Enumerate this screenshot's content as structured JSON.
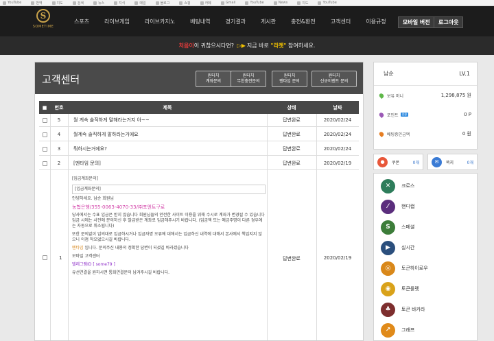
{
  "bookmarks": [
    "YouTube",
    "번역",
    "지도",
    "검색",
    "뉴스",
    "지식",
    "메일",
    "블로그",
    "쇼핑",
    "카페",
    "Gmail",
    "YouTube",
    "News",
    "지도",
    "YouTube"
  ],
  "nav": {
    "logo_text": "SOMETIME",
    "menu": [
      "스포츠",
      "라이브게임",
      "라이브카지노",
      "베팅내역",
      "경기결과",
      "게시판",
      "충전&환전",
      "고객센터",
      "이용규정"
    ],
    "mobile_label": "모바일 버전",
    "logout_label": "로그아웃"
  },
  "notice": {
    "red": "처음이",
    "text1": "이 귀찮으시다면?",
    "arrows": "▷▶",
    "text2": "지금 바로",
    "highlight": "\"라젯\"",
    "text3": "참여하세요."
  },
  "cs": {
    "title": "고객센터",
    "buttons": [
      {
        "line1": "원터치",
        "line2": "계좌문의"
      },
      {
        "line1": "원터치",
        "line2": "무한충전문의"
      },
      {
        "line1": "원터치",
        "line2": "멘타임 문의"
      },
      {
        "line1": "원터치",
        "line2": "신규이벤트 문의"
      }
    ]
  },
  "table": {
    "headers": {
      "check": "■",
      "num": "번호",
      "title": "제목",
      "status": "상태",
      "date": "날짜"
    },
    "rows": [
      {
        "num": "5",
        "title": "월 계속 솔직하게 말해라는거지 아~~",
        "status": "답변완료",
        "date": "2020/02/24"
      },
      {
        "num": "4",
        "title": "월계속 솔직하게 말하라는거에요",
        "status": "답변완료",
        "date": "2020/02/24"
      },
      {
        "num": "3",
        "title": "뭐하시는거에요?",
        "status": "답변완료",
        "date": "2020/02/24"
      },
      {
        "num": "2",
        "title": "[멘타임 문의]",
        "status": "답변완료",
        "date": "2020/02/19"
      }
    ],
    "expanded": {
      "num": "1",
      "status": "답변완료",
      "date": "2020/02/19",
      "title": "[입금계좌문의]",
      "title2": "[입금계좌문의]",
      "greeting": "안녕하세요. 남순 회원님",
      "account": "농협은행/355-0063-4070-33/㈜포엔트구로",
      "para1": "당사에서는 수표 입금은 받지 않습니다 회원님들의 안전한 사이트 이용을 위해 수시로 계좌가 변경될 수 있습니다 입금 시에는 사전에 문의하신 후 발급받은 계좌로 입금해주시기 바랍니다. (입금액 또는 예금주명이 다른 경우에는 자동으로 취소됩니다)",
      "para2": "또한 문의없이 임의대로 입금하시거나 입금자명 오류에 대해서는 입금하신 내역에 대해서 본사에서 책임지지 않으니 이점 착오없으시길 바랍니다.",
      "orange": "멘타임",
      "para3": "입니다. 문의주신 내용의 정확한 답변이 되셨길 바라겠습니다",
      "sign": "모바일 고객센터",
      "telegram": "텔레그램ID [ some79 ]",
      "para4": "유선연결을 원하시면 통화연결문의 남겨주시길 바랍니다."
    }
  },
  "user": {
    "name": "남순",
    "level": "LV.1",
    "stats": [
      {
        "label": "보유 머니",
        "value": "1,298,875 원",
        "color": "#5fb84a"
      },
      {
        "label": "포인트",
        "tag": "전환",
        "value": "0 P",
        "color": "#9b59b6"
      },
      {
        "label": "배팅중인금액",
        "value": "0 원",
        "color": "#e67e22"
      }
    ],
    "coupon": {
      "label": "쿠폰",
      "count": "0개"
    },
    "message": {
      "label": "쪽지",
      "count": "0개"
    }
  },
  "games": [
    {
      "label": "크로스",
      "icon": "✕",
      "color": "#2e7d5b"
    },
    {
      "label": "핸디캡",
      "icon": "⁄",
      "color": "#5b2e7d"
    },
    {
      "label": "스페셜",
      "icon": "S",
      "color": "#3d7d3a"
    },
    {
      "label": "실시간",
      "icon": "▶",
      "color": "#2b4f7d"
    },
    {
      "label": "토큰하이로우",
      "icon": "◎",
      "color": "#d9881a"
    },
    {
      "label": "토큰룰렛",
      "icon": "◉",
      "color": "#d9a21a"
    },
    {
      "label": "토큰 바카라",
      "icon": "♣",
      "color": "#7d2e2e"
    },
    {
      "label": "그래프",
      "icon": "↗",
      "color": "#e08a1a"
    }
  ],
  "colors": {
    "nav_bg": "#1c1c1c",
    "accent": "#c9a24a",
    "table_head": "#474747",
    "account_pink": "#d23fa7"
  }
}
